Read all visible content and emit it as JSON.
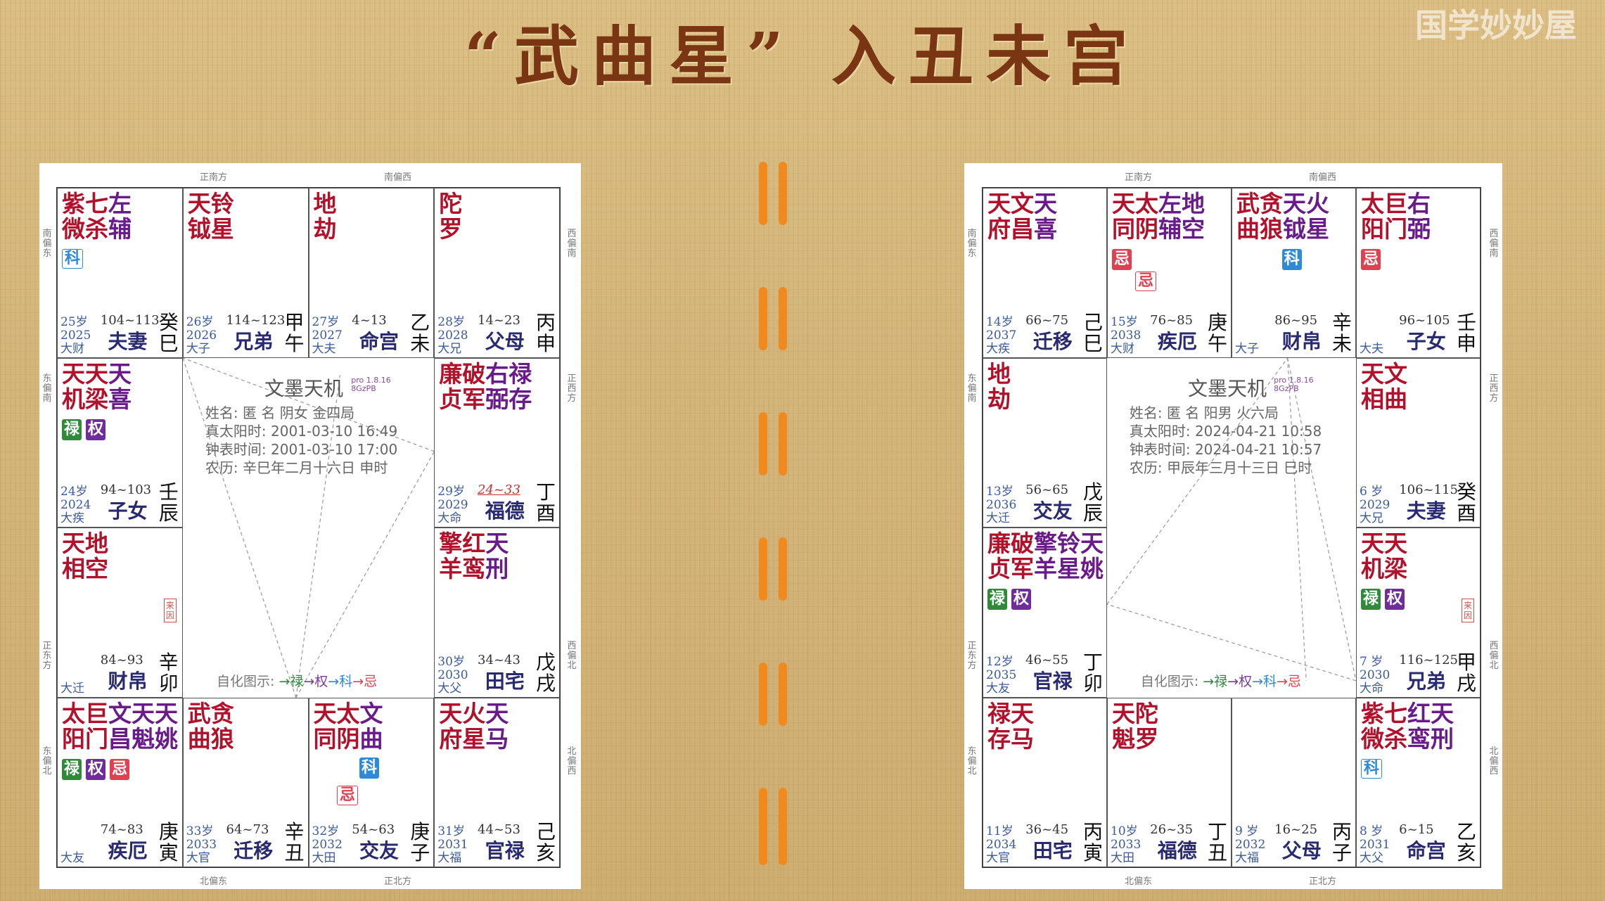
{
  "title": "“武曲星” 入丑未宫",
  "watermark": "国学妙妙屋",
  "watermark_logo": "bili",
  "colors": {
    "divider": "#f08a1e",
    "title": "#7a3512",
    "lu": "#2f8a3a",
    "quan": "#6e2d9b",
    "ji": "#e04050",
    "ke": "#2c8ad8"
  },
  "chart_a": {
    "dirs": {
      "top1": "正南方",
      "top2": "南偏西",
      "bottom1": "北偏东",
      "bottom2": "正北方",
      "left1": "南偏东",
      "left2": "东偏南",
      "left3": "正东方",
      "left4": "东偏北",
      "right1": "西偏南",
      "right2": "正西方",
      "right3": "西偏北",
      "right4": "北偏西"
    },
    "center": {
      "title": "文墨天机",
      "ver1": "pro 1.8.16",
      "ver2": "8GzPB",
      "line1": "姓名: 匿 名        阴女 金四局",
      "line2": "真太阳时: 2001-03-10 16:49",
      "line3": "钟表时间: 2001-03-10 17:00",
      "line4": "农历: 辛巳年二月十六日 申时",
      "hua_label": "自化图示:",
      "hua_lu": "→禄",
      "hua_quan": "→权",
      "hua_ke": "→科",
      "hua_ji": "→忌"
    },
    "cells": [
      {
        "r1": "紫七左",
        "r2": "微杀辅",
        "age": "25岁",
        "year": "2025",
        "da": "大财",
        "range": "104~113",
        "palace": "夫妻",
        "g1": "癸",
        "g2": "巳",
        "ke": "科"
      },
      {
        "r1": "天铃",
        "r2": "钺星",
        "age": "26岁",
        "year": "2026",
        "da": "大子",
        "range": "114~123",
        "palace": "兄弟",
        "g1": "甲",
        "g2": "午"
      },
      {
        "r1": "地",
        "r2": "劫",
        "age": "27岁",
        "year": "2027",
        "da": "大夫",
        "range": "4~13",
        "palace": "命宫",
        "g1": "乙",
        "g2": "未"
      },
      {
        "r1": "陀",
        "r2": "罗",
        "age": "28岁",
        "year": "2028",
        "da": "大兄",
        "range": "14~23",
        "palace": "父母",
        "g1": "丙",
        "g2": "申"
      },
      {
        "r1": "天天天",
        "r2": "机梁喜",
        "age": "24岁",
        "year": "2024",
        "da": "大疾",
        "range": "94~103",
        "palace": "子女",
        "g1": "壬",
        "g2": "辰",
        "lu": "禄",
        "quan": "权"
      },
      {
        "r1": "廉破右禄",
        "r2": "贞军弼存",
        "age": "29岁",
        "year": "2029",
        "da": "大命",
        "range": "24~33",
        "palace": "福德",
        "g1": "丁",
        "g2": "酉"
      },
      {
        "r1": "天地",
        "r2": "相空",
        "da": "大迁",
        "range": "84~93",
        "palace": "财帛",
        "g1": "辛",
        "g2": "卯",
        "laiyin": "来因"
      },
      {
        "r1": "擎红天",
        "r2": "羊鸾刑",
        "age": "30岁",
        "year": "2030",
        "da": "大父",
        "range": "34~43",
        "palace": "田宅",
        "g1": "戊",
        "g2": "戌"
      },
      {
        "r1": "太巨文天天",
        "r2": "阳门昌魁姚",
        "da": "大友",
        "range": "74~83",
        "palace": "疾厄",
        "g1": "庚",
        "g2": "寅",
        "quan": "权",
        "lu": "禄",
        "ji": "忌"
      },
      {
        "r1": "武贪",
        "r2": "曲狼",
        "age": "33岁",
        "year": "2033",
        "da": "大官",
        "range": "64~73",
        "palace": "迁移",
        "g1": "辛",
        "g2": "丑"
      },
      {
        "r1": "天太文",
        "r2": "同阴曲",
        "age": "32岁",
        "year": "2032",
        "da": "大田",
        "range": "54~63",
        "palace": "交友",
        "g1": "庚",
        "g2": "子",
        "ke": "科",
        "ji": "忌"
      },
      {
        "r1": "天火天",
        "r2": "府星马",
        "age": "31岁",
        "year": "2031",
        "da": "大福",
        "range": "44~53",
        "palace": "官禄",
        "g1": "己",
        "g2": "亥"
      }
    ]
  },
  "chart_b": {
    "dirs": {
      "top1": "正南方",
      "top2": "南偏西",
      "bottom1": "北偏东",
      "bottom2": "正北方",
      "left1": "南偏东",
      "left2": "东偏南",
      "left3": "正东方",
      "left4": "东偏北",
      "right1": "西偏南",
      "right2": "正西方",
      "right3": "西偏北",
      "right4": "北偏西"
    },
    "center": {
      "title": "文墨天机",
      "ver1": "pro 1.8.16",
      "ver2": "8GzPB",
      "line1": "姓名: 匿 名        阳男 火六局",
      "line2": "真太阳时: 2024-04-21 10:58",
      "line3": "钟表时间: 2024-04-21 10:57",
      "line4": "农历: 甲辰年三月十三日 巳时",
      "hua_label": "自化图示:",
      "hua_lu": "→禄",
      "hua_quan": "→权",
      "hua_ke": "→科",
      "hua_ji": "→忌"
    },
    "cells": [
      {
        "r1": "天文天",
        "r2": "府昌喜",
        "age": "14岁",
        "year": "2037",
        "da": "大疾",
        "range": "66~75",
        "palace": "迁移",
        "g1": "己",
        "g2": "巳"
      },
      {
        "r1": "天太左地",
        "r2": "同阴辅空",
        "age": "15岁",
        "year": "2038",
        "da": "大财",
        "range": "76~85",
        "palace": "疾厄",
        "g1": "庚",
        "g2": "午",
        "ji": "忌"
      },
      {
        "r1": "武贪天火",
        "r2": "曲狼钺星",
        "da": "大子",
        "range": "86~95",
        "palace": "财帛",
        "g1": "辛",
        "g2": "未",
        "ke": "科"
      },
      {
        "r1": "太巨右",
        "r2": "阳门弼",
        "da": "大夫",
        "range": "96~105",
        "palace": "子女",
        "g1": "壬",
        "g2": "申",
        "ji": "忌"
      },
      {
        "r1": "地",
        "r2": "劫",
        "age": "13岁",
        "year": "2036",
        "da": "大迁",
        "range": "56~65",
        "palace": "交友",
        "g1": "戊",
        "g2": "辰"
      },
      {
        "r1": "天文",
        "r2": "相曲",
        "age": "6 岁",
        "year": "2029",
        "da": "大兄",
        "range": "106~115",
        "palace": "夫妻",
        "g1": "癸",
        "g2": "酉"
      },
      {
        "r1": "廉破擎铃天",
        "r2": "贞军羊星姚",
        "age": "12岁",
        "year": "2035",
        "da": "大友",
        "range": "46~55",
        "palace": "官禄",
        "g1": "丁",
        "g2": "卯",
        "lu": "禄",
        "quan": "权"
      },
      {
        "r1": "天天",
        "r2": "机梁",
        "age": "7 岁",
        "year": "2030",
        "da": "大命",
        "range": "116~125",
        "palace": "兄弟",
        "g1": "甲",
        "g2": "戌",
        "lu": "禄",
        "quan": "权",
        "laiyin": "来因"
      },
      {
        "r1": "禄天",
        "r2": "存马",
        "age": "11岁",
        "year": "2034",
        "da": "大官",
        "range": "36~45",
        "palace": "田宅",
        "g1": "丙",
        "g2": "寅"
      },
      {
        "r1": "天陀",
        "r2": "魁罗",
        "age": "10岁",
        "year": "2033",
        "da": "大田",
        "range": "26~35",
        "palace": "福德",
        "g1": "丁",
        "g2": "丑"
      },
      {
        "r1": "",
        "r2": "",
        "age": "9 岁",
        "year": "2032",
        "da": "大福",
        "range": "16~25",
        "palace": "父母",
        "g1": "丙",
        "g2": "子"
      },
      {
        "r1": "紫七红天",
        "r2": "微杀鸾刑",
        "age": "8 岁",
        "year": "2031",
        "da": "大父",
        "range": "6~15",
        "palace": "命宫",
        "g1": "乙",
        "g2": "亥",
        "ke": "科"
      }
    ]
  }
}
